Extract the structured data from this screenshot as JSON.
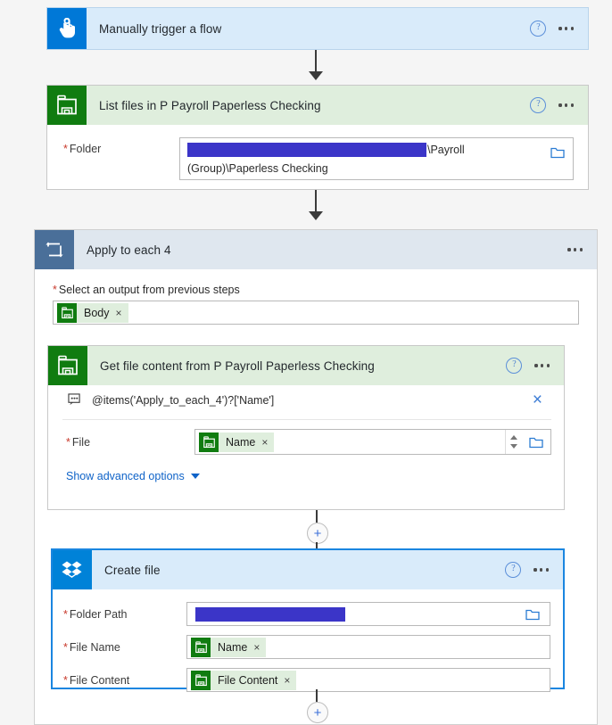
{
  "trigger": {
    "title": "Manually trigger a flow",
    "icon": "touch-trigger-icon",
    "icon_color": "#0078d7",
    "header_bg": "#d9ebfa"
  },
  "list_files": {
    "title": "List files in P Payroll Paperless Checking",
    "icon": "sharepoint-icon",
    "icon_color": "#107c10",
    "header_bg": "#dfeedd",
    "folder_label": "Folder",
    "folder_required": "*",
    "folder_value_redacted": true,
    "folder_value_suffix": "\\Payroll",
    "folder_value_line2": "(Group)\\Paperless Checking",
    "folder_picker_icon": "folder-picker-icon"
  },
  "apply_to_each": {
    "title": "Apply to each 4",
    "icon": "loop-icon",
    "icon_color": "#4a6f99",
    "header_bg": "#dfe7ef",
    "select_label": "Select an output from previous steps",
    "select_required": "*",
    "token": {
      "label": "Body",
      "icon": "sharepoint-icon",
      "remove": "×"
    }
  },
  "get_file_content": {
    "title": "Get file content from P Payroll Paperless Checking",
    "icon": "sharepoint-icon",
    "header_bg": "#dfeedd",
    "expression": "@items('Apply_to_each_4')?['Name']",
    "expression_icon": "expression-icon",
    "expression_close": "×",
    "file_label": "File",
    "file_required": "*",
    "file_token": {
      "label": "Name",
      "icon": "sharepoint-icon",
      "remove": "×"
    },
    "advanced_link": "Show advanced options"
  },
  "create_file": {
    "title": "Create file",
    "icon": "dropbox-icon",
    "icon_color": "#0082d8",
    "header_bg": "#d9ebfa",
    "selected": true,
    "fields": [
      {
        "label": "Folder Path",
        "required": "*",
        "type": "redacted"
      },
      {
        "label": "File Name",
        "required": "*",
        "type": "token",
        "token": {
          "label": "Name",
          "icon": "sharepoint-icon",
          "remove": "×"
        }
      },
      {
        "label": "File Content",
        "required": "*",
        "type": "token",
        "token": {
          "label": "File Content",
          "icon": "sharepoint-icon",
          "remove": "×"
        }
      }
    ]
  },
  "connectors": {
    "add_step_label": "+",
    "help_glyph": "?"
  }
}
